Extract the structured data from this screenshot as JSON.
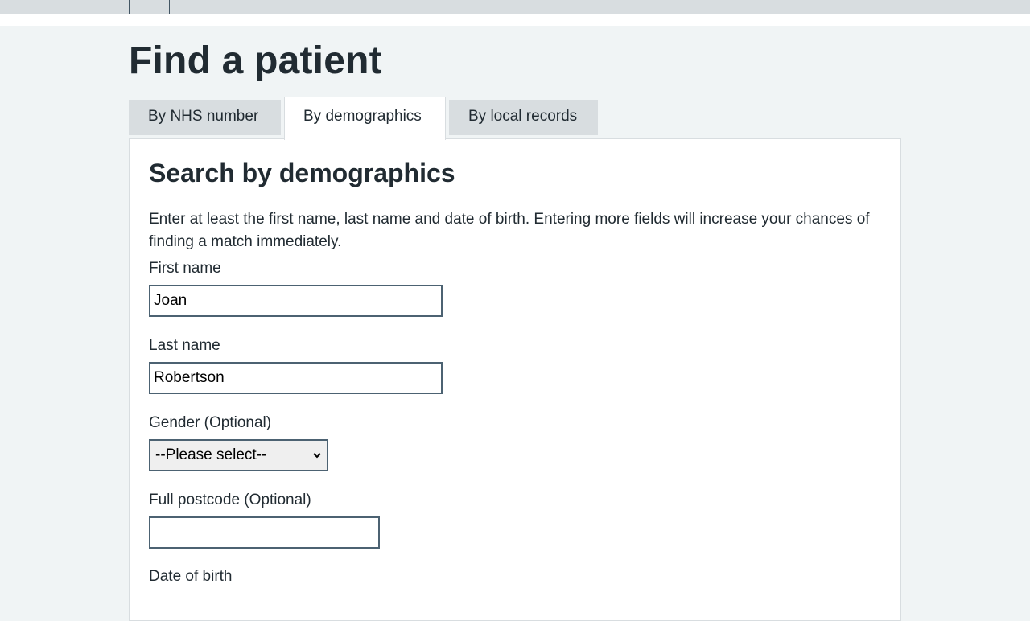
{
  "page": {
    "title": "Find a patient"
  },
  "tabs": [
    {
      "label": "By NHS number",
      "active": false
    },
    {
      "label": "By demographics",
      "active": true
    },
    {
      "label": "By local records",
      "active": false
    }
  ],
  "panel": {
    "heading": "Search by demographics",
    "intro": "Enter at least the first name, last name and date of birth. Entering more fields will increase your chances of finding a match immediately."
  },
  "form": {
    "first_name": {
      "label": "First name",
      "value": "Joan"
    },
    "last_name": {
      "label": "Last name",
      "value": "Robertson"
    },
    "gender": {
      "label": "Gender (Optional)",
      "selected": "--Please select--"
    },
    "postcode": {
      "label": "Full postcode (Optional)",
      "value": ""
    },
    "dob": {
      "label": "Date of birth"
    }
  },
  "colors": {
    "background": "#f0f4f5",
    "text": "#212b32",
    "tab_inactive": "#d8dde0",
    "input_border": "#4c6272"
  },
  "icons": {
    "select_arrow": "chevron-down-icon"
  }
}
